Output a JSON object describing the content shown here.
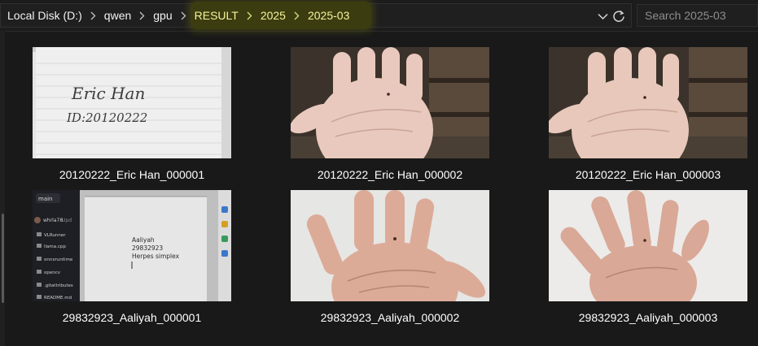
{
  "breadcrumb": [
    {
      "label": "Local Disk (D:)",
      "highlighted": false
    },
    {
      "label": "qwen",
      "highlighted": false
    },
    {
      "label": "gpu",
      "highlighted": false
    },
    {
      "label": "RESULT",
      "highlighted": true
    },
    {
      "label": "2025",
      "highlighted": true
    },
    {
      "label": "2025-03",
      "highlighted": true
    }
  ],
  "search": {
    "placeholder": "Search 2025-03"
  },
  "icons": {
    "separator": "chevron-right-icon",
    "history": "chevron-down-icon",
    "refresh": "refresh-icon"
  },
  "colors": {
    "background": "#191919",
    "highlight": "#3b3d10",
    "highlight_text": "#f4f39a"
  },
  "files": [
    {
      "name": "20120222_Eric Han_000001",
      "preview": "handwritten-note",
      "note_lines": [
        "Eric Han",
        "ID:20120222"
      ]
    },
    {
      "name": "20120222_Eric Han_000002",
      "preview": "palm-photo"
    },
    {
      "name": "20120222_Eric Han_000003",
      "preview": "palm-photo"
    },
    {
      "name": "29832923_Aaliyah_000001",
      "preview": "screen-photo",
      "screen": {
        "branch": "main",
        "user": "whrla78",
        "status": "Upd",
        "sidebar": [
          "VLRunner",
          "llama.cpp",
          "onnxruntime",
          "opencv",
          ".gitattributes",
          "README.md"
        ],
        "text_lines": [
          "Aaliyah",
          "29832923",
          "Herpes simplex"
        ]
      }
    },
    {
      "name": "29832923_Aaliyah_000002",
      "preview": "palm-photo"
    },
    {
      "name": "29832923_Aaliyah_000003",
      "preview": "palm-photo"
    }
  ]
}
